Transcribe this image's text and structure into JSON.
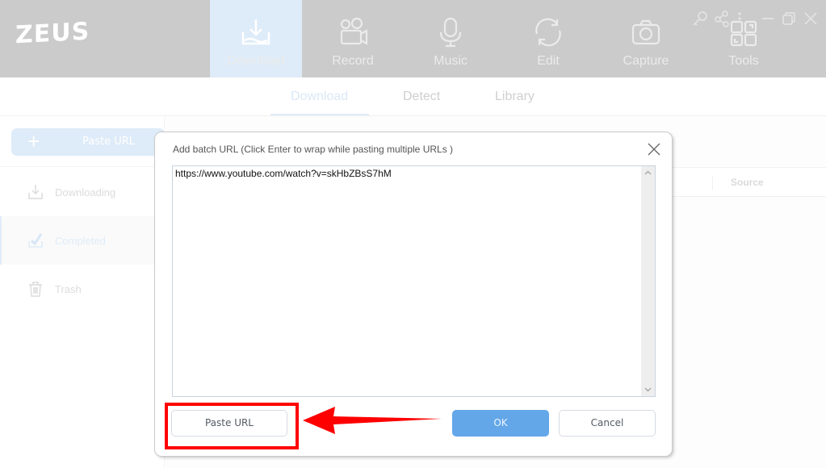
{
  "app": {
    "logo": "ZEUS",
    "nav": [
      {
        "label": "Download",
        "icon": "download-tray-icon",
        "active": true
      },
      {
        "label": "Record",
        "icon": "video-camera-icon",
        "active": false
      },
      {
        "label": "Music",
        "icon": "microphone-icon",
        "active": false
      },
      {
        "label": "Edit",
        "icon": "refresh-cycle-icon",
        "active": false
      },
      {
        "label": "Capture",
        "icon": "camera-icon",
        "active": false
      },
      {
        "label": "Tools",
        "icon": "tools-grid-icon",
        "active": false
      }
    ],
    "window_controls": [
      "key-icon",
      "share-icon",
      "menu-dots-icon",
      "minimize-icon",
      "restore-icon",
      "close-icon"
    ]
  },
  "subtabs": [
    {
      "label": "Download",
      "active": true
    },
    {
      "label": "Detect",
      "active": false
    },
    {
      "label": "Library",
      "active": false
    }
  ],
  "sidebar": {
    "paste_button": "Paste URL",
    "items": [
      {
        "label": "Downloading",
        "icon": "download-icon",
        "active": false
      },
      {
        "label": "Completed",
        "icon": "checkmark-icon",
        "active": true
      },
      {
        "label": "Trash",
        "icon": "trash-icon",
        "active": false
      }
    ]
  },
  "table": {
    "columns": [
      "Source"
    ]
  },
  "dialog": {
    "title": "Add batch URL (Click Enter to wrap while pasting multiple URLs )",
    "url_value": "https://www.youtube.com/watch?v=skHbZBsS7hM",
    "paste_button": "Paste URL",
    "ok_button": "OK",
    "cancel_button": "Cancel"
  },
  "annotation": {
    "highlight_color": "#ff0000",
    "target": "Paste URL"
  },
  "colors": {
    "header_bg": "#cbcbcb",
    "active_nav_bg": "#deebf8",
    "ok_button": "#63a7e9"
  }
}
